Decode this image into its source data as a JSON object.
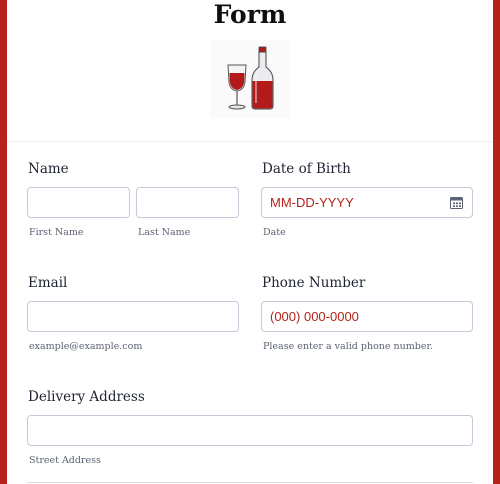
{
  "form": {
    "title": "Form",
    "logo": {
      "icon": "wine-bottle-and-glass-icon",
      "colors": {
        "wine": "#b31b1b",
        "glass": "#e6e6ea"
      }
    },
    "accent_color": "#b5231b"
  },
  "name": {
    "label": "Name",
    "first": {
      "value": "",
      "sublabel": "First Name"
    },
    "last": {
      "value": "",
      "sublabel": "Last Name"
    }
  },
  "dob": {
    "label": "Date of Birth",
    "placeholder": "MM-DD-YYYY",
    "sublabel": "Date",
    "icon": "calendar-icon"
  },
  "email": {
    "label": "Email",
    "value": "",
    "sublabel": "example@example.com"
  },
  "phone": {
    "label": "Phone Number",
    "placeholder": "(000) 000-0000",
    "sublabel": "Please enter a valid phone number."
  },
  "address": {
    "label": "Delivery Address",
    "value": "",
    "sublabel": "Street Address"
  }
}
